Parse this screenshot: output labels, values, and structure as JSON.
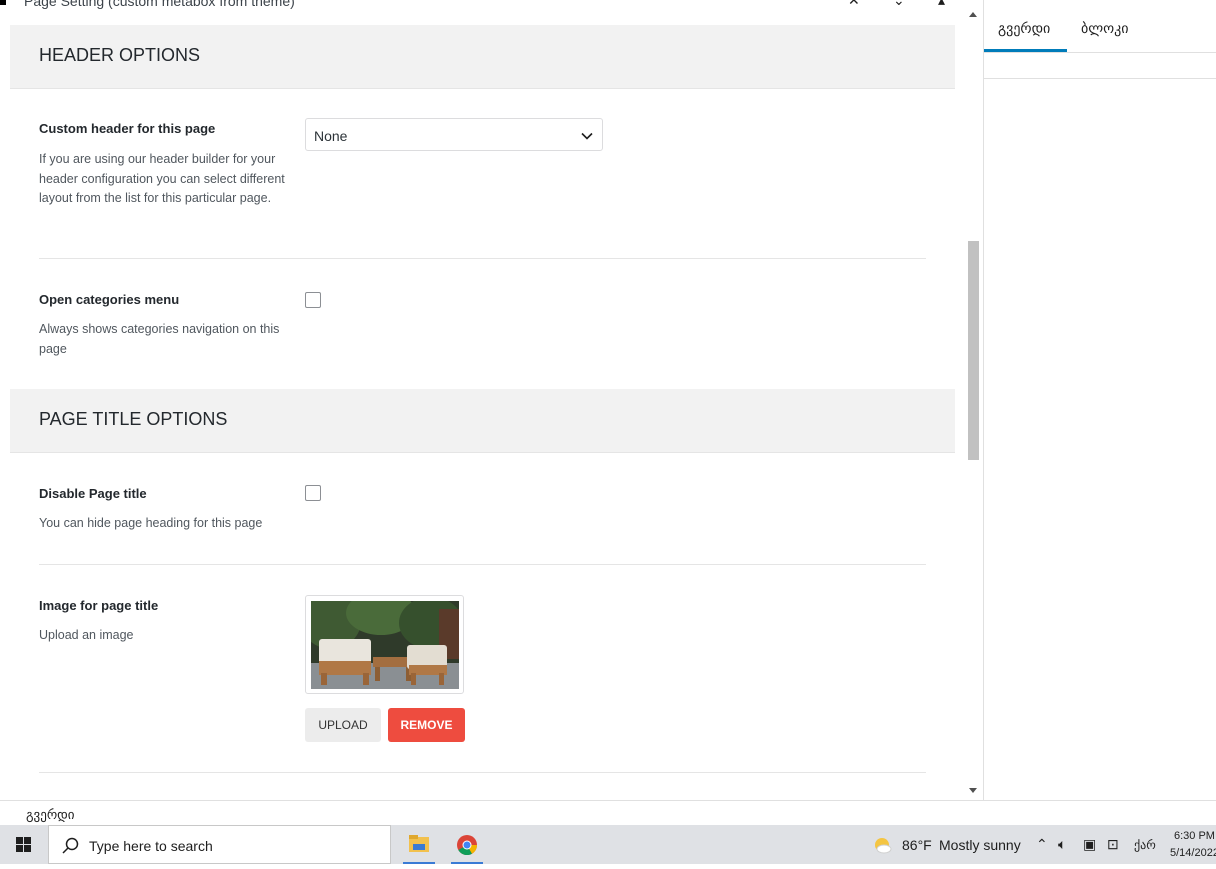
{
  "metabox": {
    "title": "Page Setting (custom metabox from theme)"
  },
  "sections": {
    "header": {
      "title": "HEADER OPTIONS"
    },
    "page_title": {
      "title": "PAGE TITLE OPTIONS"
    }
  },
  "options": {
    "custom_header": {
      "label": "Custom header for this page",
      "desc": "If you are using our header builder for your header configuration you can select different layout from the list for this particular page.",
      "value": "None"
    },
    "open_categories": {
      "label": "Open categories menu",
      "desc": "Always shows categories navigation on this page"
    },
    "disable_title": {
      "label": "Disable Page title",
      "desc": "You can hide page heading for this page"
    },
    "title_image": {
      "label": "Image for page title",
      "desc": "Upload an image",
      "upload_label": "UPLOAD",
      "remove_label": "REMOVE"
    }
  },
  "sidebar": {
    "tabs": [
      "გვერდი",
      "ბლოკი"
    ],
    "active_tab": 0
  },
  "footer": {
    "breadcrumb": "გვერდი"
  },
  "taskbar": {
    "search_placeholder": "Type here to search",
    "weather_temp": "86°F",
    "weather_desc": "Mostly sunny",
    "language": "ქარ",
    "time": "6:30 PM",
    "date": "5/14/2022"
  },
  "colors": {
    "accent": "#007cba",
    "remove_button": "#ee4c3f",
    "section_bg": "#f2f2f2"
  }
}
